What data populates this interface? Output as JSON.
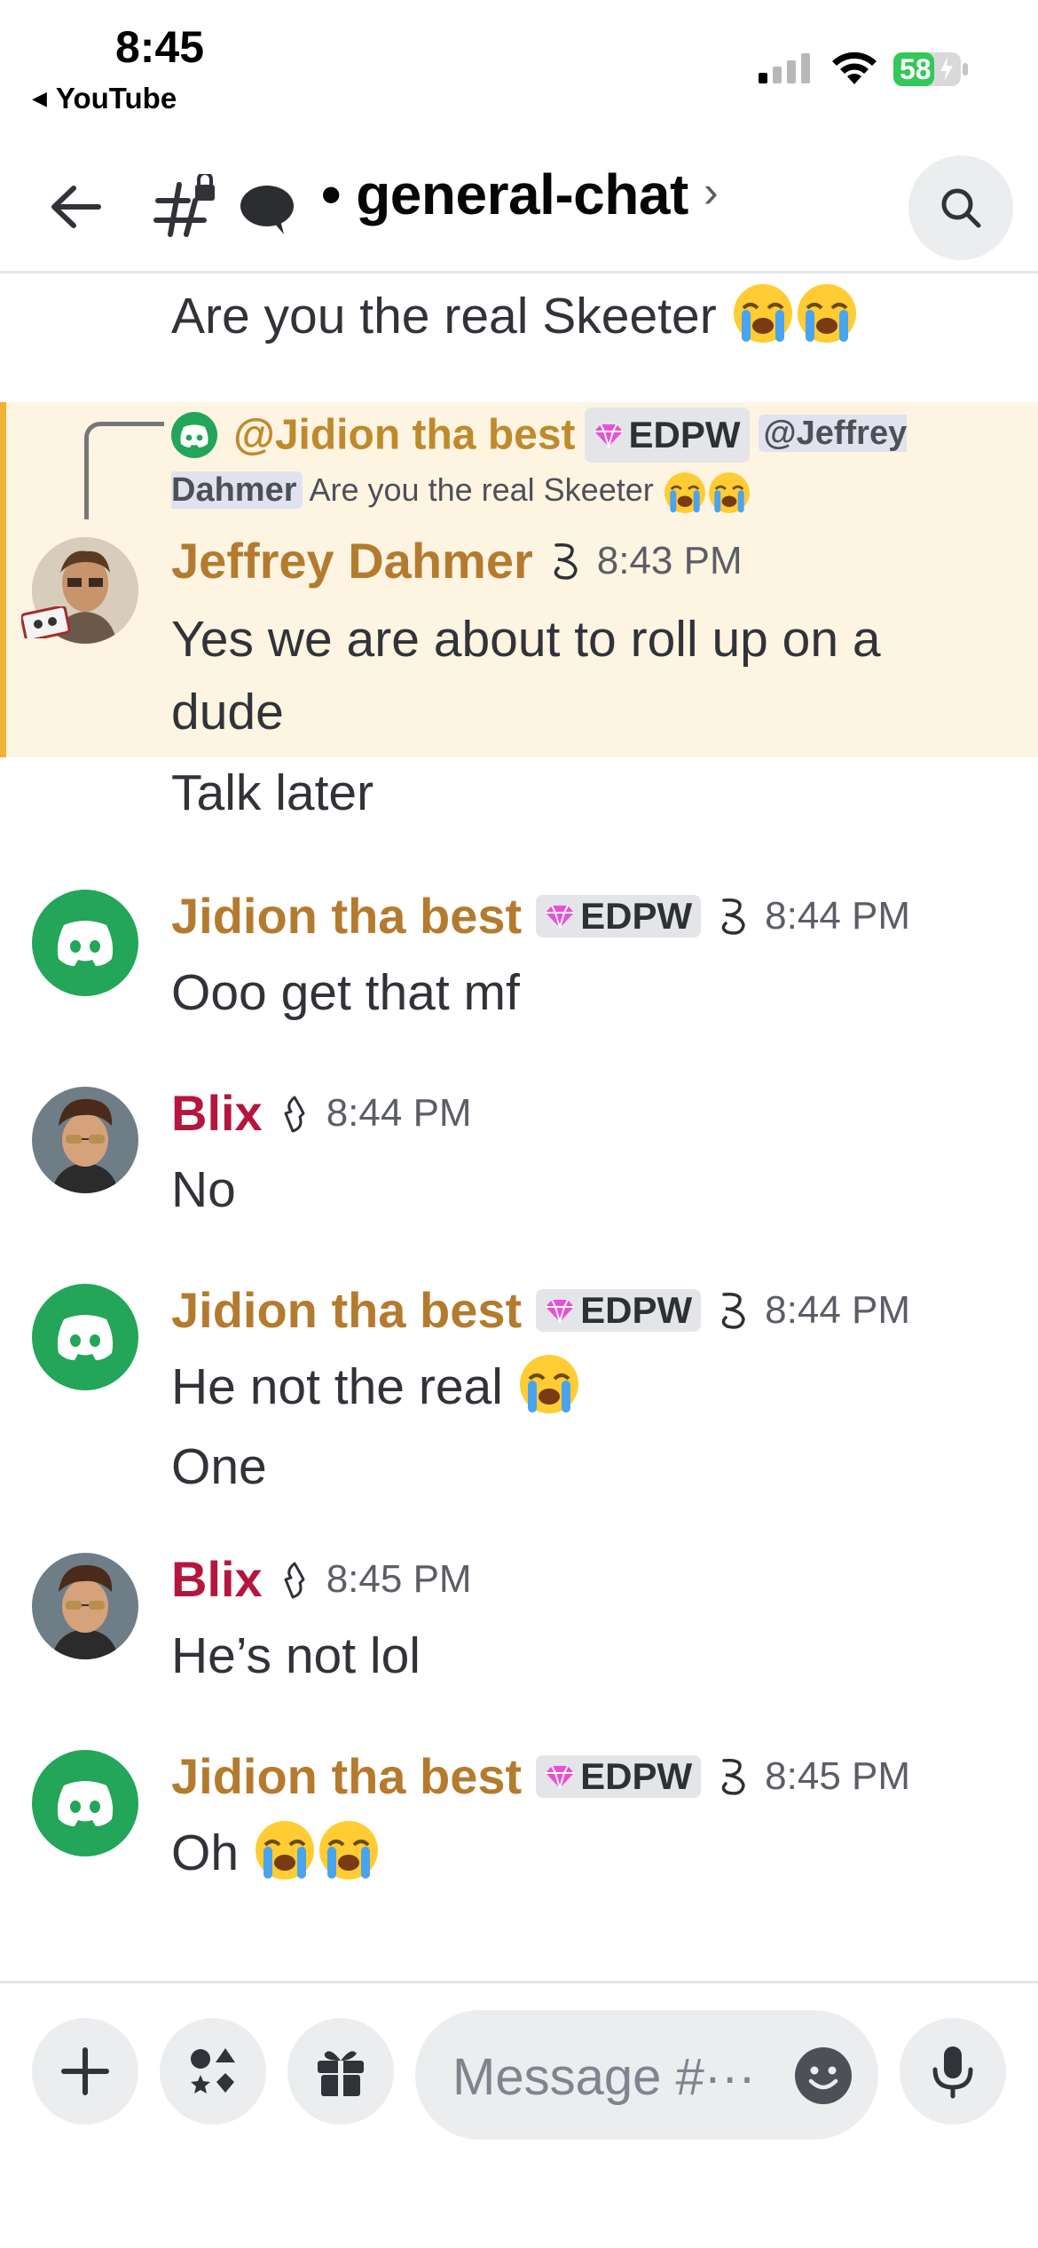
{
  "status_bar": {
    "time": "8:45",
    "back_app": "YouTube",
    "battery": "58"
  },
  "header": {
    "channel_title": "• general-chat",
    "chevron": "›"
  },
  "messages": {
    "prev_continuation": "Are you the real Skeeter",
    "reply_preview": {
      "author": "@Jidion tha best",
      "tag": "EDPW",
      "mention": "@Jeffrey Dahmer",
      "text": "Are you the real Skeeter"
    },
    "items": [
      {
        "author": "Jeffrey Dahmer",
        "time": "8:43 PM",
        "lines": [
          "Yes we are about to roll up on a",
          "dude"
        ],
        "continuation": "Talk later"
      },
      {
        "author": "Jidion tha best",
        "tag": "EDPW",
        "time": "8:44 PM",
        "lines": [
          "Ooo get that  mf"
        ]
      },
      {
        "author": "Blix",
        "time": "8:44 PM",
        "lines": [
          "No"
        ]
      },
      {
        "author": "Jidion tha best",
        "tag": "EDPW",
        "time": "8:44 PM",
        "lines": [
          "He not the real",
          "One"
        ]
      },
      {
        "author": "Blix",
        "time": "8:45 PM",
        "lines": [
          "He’s not lol"
        ]
      },
      {
        "author": "Jidion tha best",
        "tag": "EDPW",
        "time": "8:45 PM",
        "lines": [
          "Oh"
        ]
      }
    ]
  },
  "input": {
    "placeholder": "Message #···"
  },
  "colors": {
    "accent_gold": "#b47b2e",
    "accent_red": "#b5163e",
    "discord_green": "#23a55a",
    "highlight_bg": "#fdf4e2",
    "highlight_bar": "#f0b232"
  }
}
